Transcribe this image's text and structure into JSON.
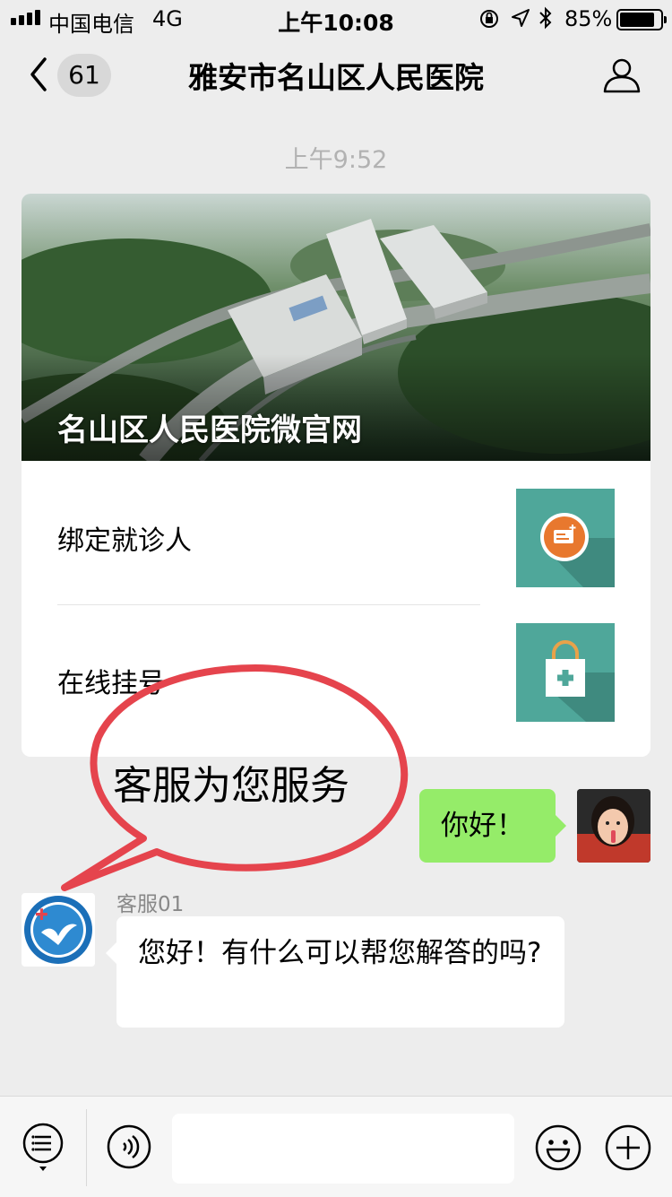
{
  "status_bar": {
    "carrier": "中国电信",
    "network": "4G",
    "time": "上午10:08",
    "battery": "85%"
  },
  "nav": {
    "unread_count": "61",
    "title": "雅安市名山区人民医院",
    "back_icon": "chevron-left-icon",
    "profile_icon": "person-icon"
  },
  "chat": {
    "timestamp": "上午9:52",
    "article_card": {
      "banner_title": "名山区人民医院微官网",
      "menu_items": [
        {
          "label": "绑定就诊人",
          "icon": "id-card-add-icon"
        },
        {
          "label": "在线挂号",
          "icon": "medical-bag-icon"
        }
      ]
    },
    "annotation": "客服为您服务",
    "my_message": "你好！",
    "agent_name": "客服01",
    "agent_message": "您好！有什么可以帮您解答的吗?"
  },
  "input_bar": {
    "menu_icon": "list-menu-icon",
    "voice_icon": "voice-icon",
    "emoji_icon": "emoji-icon",
    "plus_icon": "plus-icon"
  },
  "colors": {
    "background": "#ededed",
    "my_bubble": "#95ec69",
    "thumb_teal": "#4fa79a",
    "annotation_red": "#e5444d",
    "accent_orange": "#e8782e"
  }
}
